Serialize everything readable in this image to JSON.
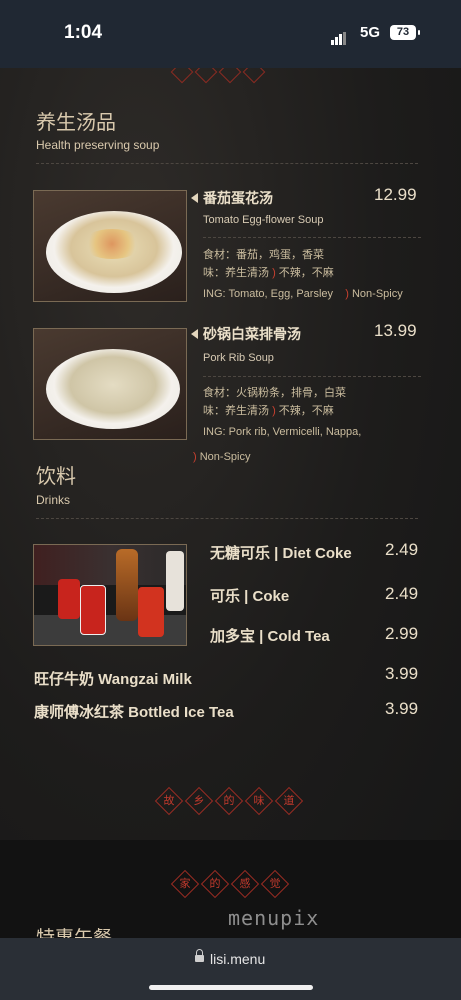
{
  "status_bar": {
    "time": "1:04",
    "network": "5G",
    "battery": "73"
  },
  "soup_section": {
    "title_cn": "养生汤品",
    "title_en": "Health preserving soup",
    "items": [
      {
        "name": "番茄蛋花汤",
        "name_en": "Tomato Egg-flower Soup",
        "price": "12.99",
        "ingredients_cn": "食材：番茄，鸡蛋，香菜",
        "taste_cn": "味：养生清汤",
        "spicy_cn": "不辣，不麻",
        "ing_en": "ING: Tomato, Egg, Parsley",
        "spicy_en": "Non-Spicy"
      },
      {
        "name": "砂锅白菜排骨汤",
        "name_en": "Pork Rib Soup",
        "price": "13.99",
        "ingredients_cn": "食材：火锅粉条，排骨，白菜",
        "taste_cn": "味：养生清汤",
        "spicy_cn": "不辣，不麻",
        "ing_en": "ING: Pork rib, Vermicelli, Nappa,",
        "spicy_en": "Non-Spicy"
      }
    ]
  },
  "drinks_section": {
    "title_cn": "饮料",
    "title_en": "Drinks",
    "items": [
      {
        "name": "无糖可乐 | Diet Coke",
        "price": "2.49"
      },
      {
        "name": "可乐 | Coke",
        "price": "2.49"
      },
      {
        "name": "加多宝 | Cold Tea",
        "price": "2.99"
      },
      {
        "name": "旺仔牛奶 Wangzai Milk",
        "price": "3.99"
      },
      {
        "name": "康师傅冰红茶 Bottled Ice Tea",
        "price": "3.99"
      }
    ]
  },
  "banner_1": [
    "故",
    "乡",
    "的",
    "味",
    "道"
  ],
  "banner_2": [
    "家",
    "的",
    "感",
    "觉"
  ],
  "watermark": "menupix",
  "special_heading": "特惠午餐",
  "url_bar": {
    "url": "lisi.menu"
  }
}
